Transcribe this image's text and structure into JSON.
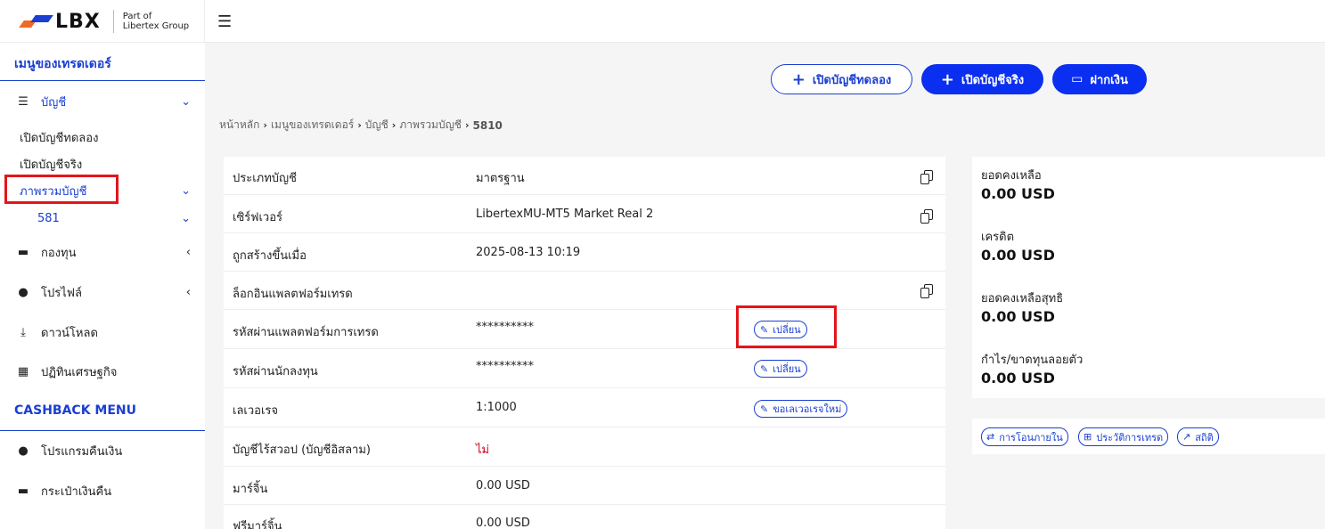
{
  "brand": {
    "logo_text": "LBX",
    "sub_line1": "Part of",
    "sub_line2": "Libertex Group"
  },
  "sidebar": {
    "section1": "เมนูของเทรดเดอร์",
    "accounts_label": "บัญชี",
    "open_demo": "เปิดบัญชีทดลอง",
    "open_real": "เปิดบัญชีจริง",
    "overview": "ภาพรวมบัญชี",
    "account_number": "581",
    "funds": "กองทุน",
    "profile": "โปรไฟล์",
    "download": "ดาวน์โหลด",
    "calendar": "ปฏิทินเศรษฐกิจ",
    "section2": "CASHBACK MENU",
    "cashback_program": "โปรแกรมคืนเงิน",
    "cashback_wallet": "กระเป๋าเงินคืน"
  },
  "header_buttons": {
    "open_demo": "เปิดบัญชีทดลอง",
    "open_real": "เปิดบัญชีจริง",
    "deposit": "ฝากเงิน"
  },
  "breadcrumb": [
    "หน้าหลัก",
    "เมนูของเทรดเดอร์",
    "บัญชี",
    "ภาพรวมบัญชี",
    "5810"
  ],
  "details": {
    "rows": [
      {
        "label": "ประเภทบัญชี",
        "value": "มาตรฐาน"
      },
      {
        "label": "เซิร์ฟเวอร์",
        "value": "LibertexMU-MT5 Market Real 2"
      },
      {
        "label": "ถูกสร้างขึ้นเมื่อ",
        "value": "2025-08-13 10:19"
      },
      {
        "label": "ล็อกอินแพลตฟอร์มเทรด",
        "value": ""
      },
      {
        "label": "รหัสผ่านแพลตฟอร์มการเทรด",
        "value": "**********"
      },
      {
        "label": "รหัสผ่านนักลงทุน",
        "value": "**********"
      },
      {
        "label": "เลเวอเรจ",
        "value": "1:1000"
      },
      {
        "label": "บัญชีไร้สวอป (บัญชีอิสลาม)",
        "value": "ไม่"
      },
      {
        "label": "มาร์จิ้น",
        "value": "0.00 USD"
      },
      {
        "label": "ฟรีมาร์จิ้น",
        "value": "0.00 USD"
      }
    ],
    "change_label": "เปลี่ยน",
    "leverage_request": "ขอเลเวอเรจใหม่"
  },
  "balance": {
    "balance_label": "ยอดคงเหลือ",
    "balance_value": "0.00 USD",
    "credit_label": "เครดิต",
    "credit_value": "0.00 USD",
    "equity_label": "ยอดคงเหลือสุทธิ",
    "equity_value": "0.00 USD",
    "pl_label": "กำไร/ขาดทุนลอยตัว",
    "pl_value": "0.00 USD"
  },
  "actions": {
    "transfer": "การโอนภายใน",
    "history": "ประวัติการเทรด",
    "stats": "สถิติ"
  },
  "colors": {
    "accent": "#1a3fd1",
    "button_solid": "#0b2ff0",
    "highlight_box": "#e4141b",
    "negative_text": "#d0021b"
  }
}
